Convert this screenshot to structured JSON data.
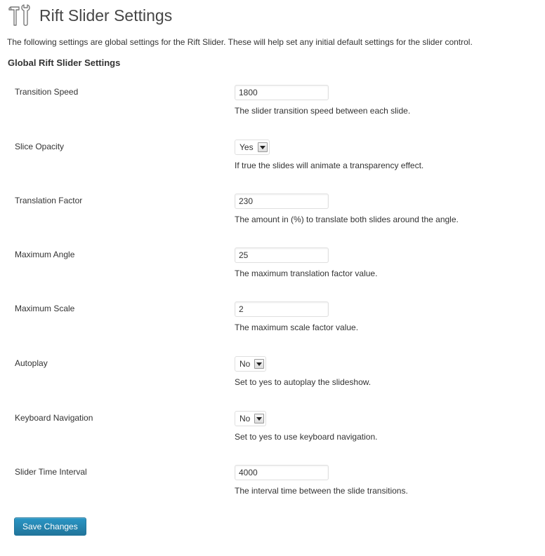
{
  "header": {
    "title": "Rift Slider Settings",
    "icon": "tools-icon"
  },
  "intro": "The following settings are global settings for the Rift Slider. These will help set any initial default settings for the slider control.",
  "section_title": "Global Rift Slider Settings",
  "settings": [
    {
      "label": "Transition Speed",
      "value": "1800",
      "description": "The slider transition speed between each slide."
    },
    {
      "label": "Slice Opacity",
      "value": "Yes",
      "description": "If true the slides will animate a transparency effect."
    },
    {
      "label": "Translation Factor",
      "value": "230",
      "description": "The amount in (%) to translate both slides around the angle."
    },
    {
      "label": "Maximum Angle",
      "value": "25",
      "description": "The maximum translation factor value."
    },
    {
      "label": "Maximum Scale",
      "value": "2",
      "description": "The maximum scale factor value."
    },
    {
      "label": "Autoplay",
      "value": "No",
      "description": "Set to yes to autoplay the slideshow."
    },
    {
      "label": "Keyboard Navigation",
      "value": "No",
      "description": "Set to yes to use keyboard navigation."
    },
    {
      "label": "Slider Time Interval",
      "value": "4000",
      "description": "The interval time between the slide transitions."
    }
  ],
  "save_label": "Save Changes",
  "colors": {
    "primary_button": "#21759b",
    "text": "#333333",
    "title": "#464646"
  }
}
